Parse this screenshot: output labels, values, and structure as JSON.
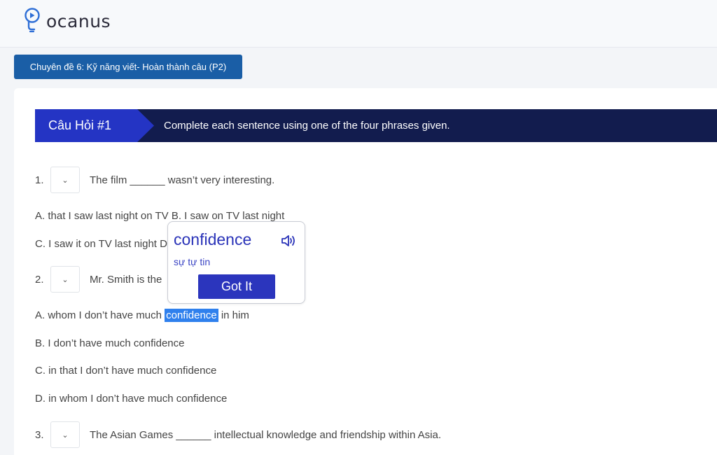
{
  "app": {
    "logo_text": "ocanus"
  },
  "chapter": {
    "label": "Chuyên đề 6: Kỹ năng viết- Hoàn thành câu (P2)"
  },
  "question": {
    "tag": "Câu Hỏi #1",
    "instruction": "Complete each sentence using one of the four phrases given."
  },
  "items": [
    {
      "number": "1.",
      "stem": "The film ______ wasn’t very interesting.",
      "options": [
        "A. that I saw last night on TV B. I saw on TV last night",
        "C. I saw it on TV last night D"
      ]
    },
    {
      "number": "2.",
      "stem": "Mr. Smith is the",
      "options": {
        "a_before": "A. whom I don’t have much",
        "a_highlight": "confidence",
        "a_after": " in him",
        "b": "B. I don’t have much confidence",
        "c": "C. in that I don’t have much confidence",
        "d": "D. in whom I don’t have much confidence"
      }
    },
    {
      "number": "3.",
      "stem": "The Asian Games ______ intellectual knowledge and friendship within Asia."
    }
  ],
  "dropdown_icon": "chevron-down-icon",
  "popup": {
    "word": "confidence",
    "meaning": "sự tự tin",
    "button": "Got It",
    "speaker_icon": "speaker-icon"
  },
  "colors": {
    "brand_blue": "#2434c4",
    "banner_dark": "#121c4e",
    "chapter_button": "#1a5ea6",
    "highlight": "#2f80ed"
  }
}
